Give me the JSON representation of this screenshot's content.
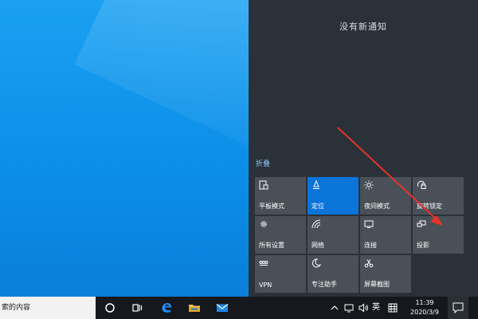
{
  "action_center": {
    "no_notifications": "没有新通知",
    "collapse": "折叠",
    "tiles": [
      {
        "label": "平板模式",
        "icon": "tablet-mode-icon",
        "active": false
      },
      {
        "label": "定位",
        "icon": "location-icon",
        "active": true
      },
      {
        "label": "夜间模式",
        "icon": "brightness-icon",
        "active": false
      },
      {
        "label": "旋转锁定",
        "icon": "rotation-lock-icon",
        "active": false
      },
      {
        "label": "所有设置",
        "icon": "gear-icon",
        "active": false
      },
      {
        "label": "网络",
        "icon": "network-icon",
        "active": false
      },
      {
        "label": "连接",
        "icon": "connect-icon",
        "active": false
      },
      {
        "label": "投影",
        "icon": "project-icon",
        "active": false
      },
      {
        "label": "VPN",
        "icon": "vpn-icon",
        "active": false
      },
      {
        "label": "专注助手",
        "icon": "moon-icon",
        "active": false
      },
      {
        "label": "屏幕截图",
        "icon": "snip-icon",
        "active": false
      }
    ]
  },
  "taskbar": {
    "search_text": "索的内容",
    "tray": {
      "input_method": "英",
      "clock_time": "11:39",
      "clock_date": "2020/3/9"
    }
  },
  "colors": {
    "desktop": "#0b8fe8",
    "action_center_bg": "#2b3138",
    "tile_bg": "#4a5058",
    "tile_active": "#0b74d9",
    "taskbar_bg": "#15181c",
    "arrow": "#e8322b"
  }
}
